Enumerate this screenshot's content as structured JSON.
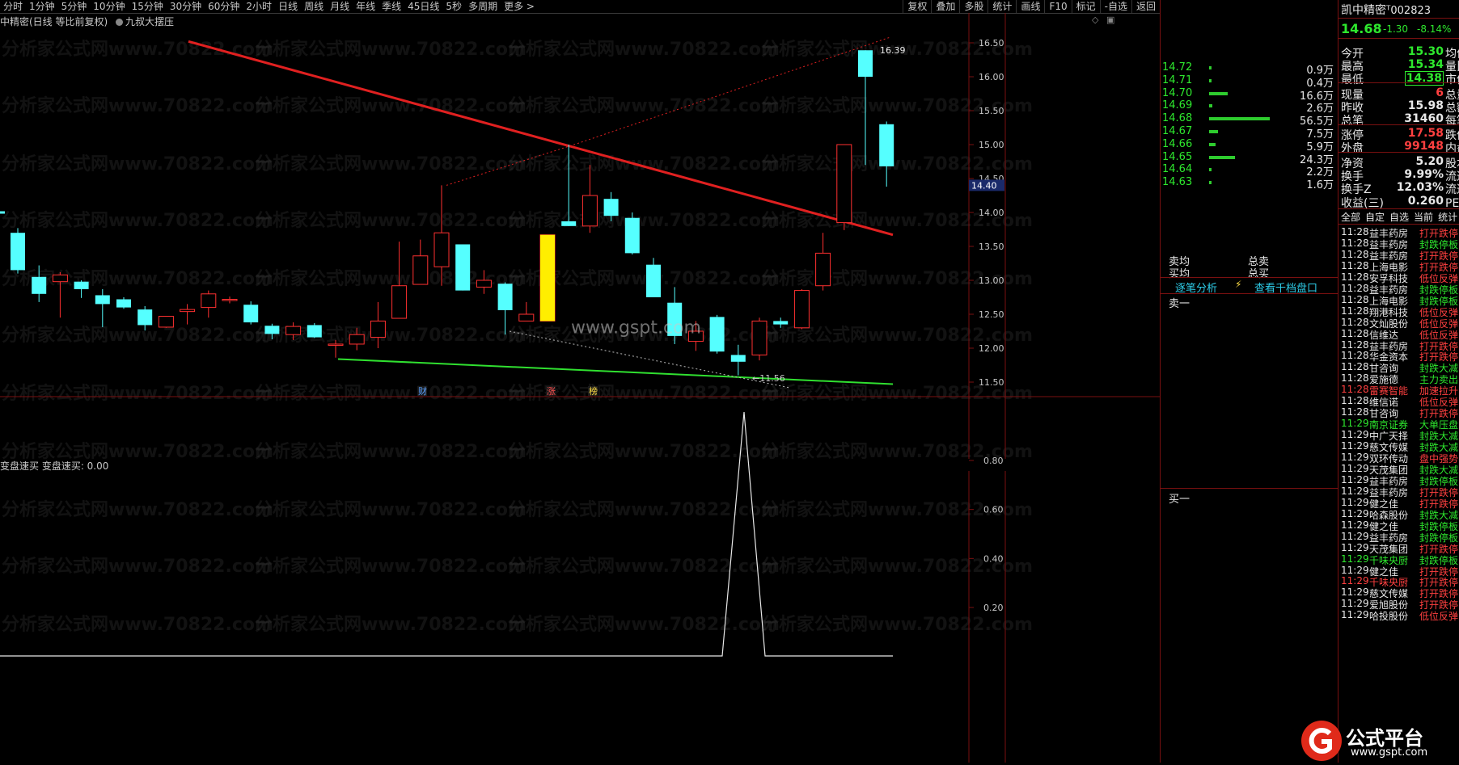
{
  "toolbar": {
    "periods": [
      "分时",
      "1分钟",
      "5分钟",
      "10分钟",
      "15分钟",
      "30分钟",
      "60分钟",
      "2小时",
      "日线",
      "周线",
      "月线",
      "年线",
      "季线",
      "45日线",
      "5秒",
      "多周期",
      "更多 >"
    ],
    "tools": [
      "复权",
      "叠加",
      "多股",
      "统计",
      "画线",
      "F10",
      "标记",
      "-自选",
      "返回"
    ]
  },
  "chart": {
    "title": "中精密(日线 等比前复权)",
    "indicator_name": "九叔大摆压",
    "marker_labels": [
      "财",
      "涨",
      "榜"
    ],
    "high_label": "16.39",
    "low_label": "11.56",
    "current_price_tag": "14.40",
    "site_text": "www.gspt.com",
    "y_ticks": [
      "16.50",
      "16.00",
      "15.50",
      "15.00",
      "14.50",
      "14.00",
      "13.50",
      "13.00",
      "12.50",
      "12.00",
      "11.50"
    ]
  },
  "indicator": {
    "title": "变盘速买  变盘速买: 0.00",
    "y_ticks": [
      "0.80",
      "0.60",
      "0.40",
      "0.20"
    ]
  },
  "watermark": "分析家公式网www.70822.com",
  "orderbook": {
    "rows": [
      {
        "price": "14.72",
        "vol": "0.9万",
        "bar": 0.02
      },
      {
        "price": "14.71",
        "vol": "0.4万",
        "bar": 0.01
      },
      {
        "price": "14.70",
        "vol": "16.6万",
        "bar": 0.3
      },
      {
        "price": "14.69",
        "vol": "2.6万",
        "bar": 0.05
      },
      {
        "price": "14.68",
        "vol": "56.5万",
        "bar": 1.0
      },
      {
        "price": "14.67",
        "vol": "7.5万",
        "bar": 0.14
      },
      {
        "price": "14.66",
        "vol": "5.9万",
        "bar": 0.11
      },
      {
        "price": "14.65",
        "vol": "24.3万",
        "bar": 0.43
      },
      {
        "price": "14.64",
        "vol": "2.2万",
        "bar": 0.04
      },
      {
        "price": "14.63",
        "vol": "1.6万",
        "bar": 0.03
      }
    ],
    "sell_avg_label": "卖均",
    "total_sell_label": "总卖",
    "buy_avg_label": "买均",
    "total_buy_label": "总买",
    "tick_analysis": "逐笔分析",
    "view_depth": "查看千档盘口",
    "sell_one": "卖一",
    "buy_one": "买一"
  },
  "quote": {
    "name": "凯中精密",
    "code": "002823",
    "price": "14.68",
    "change": "-1.30",
    "change_pct": "-8.14%",
    "rows": [
      {
        "k": "今开",
        "v": "15.30",
        "k2": "均价",
        "c": "#2ee82e"
      },
      {
        "k": "最高",
        "v": "15.34",
        "k2": "量比",
        "c": "#2ee82e"
      },
      {
        "k": "最低",
        "v": "14.38",
        "k2": "市值",
        "c": "#2ee82e"
      },
      {
        "k": "现量",
        "v": "6",
        "k2": "总量",
        "c": "#ff4040"
      },
      {
        "k": "昨收",
        "v": "15.98",
        "k2": "总额",
        "c": "#e8e8e8"
      },
      {
        "k": "总笔",
        "v": "31460",
        "k2": "每笔",
        "c": "#e8e8e8"
      },
      {
        "k": "涨停",
        "v": "17.58",
        "k2": "跌停",
        "c": "#ff4040"
      },
      {
        "k": "外盘",
        "v": "99148",
        "k2": "内盘",
        "c": "#ff4040"
      },
      {
        "k": "净资",
        "v": "5.20",
        "k2": "股本",
        "c": "#e8e8e8"
      },
      {
        "k": "换手",
        "v": "9.99%",
        "k2": "流通",
        "c": "#e8e8e8"
      },
      {
        "k": "换手Z",
        "v": "12.03%",
        "k2": "流通",
        "c": "#e8e8e8"
      },
      {
        "k": "收益(三)",
        "v": "0.260",
        "k2": "PE(动)",
        "c": "#e8e8e8"
      }
    ],
    "tabs": [
      "全部",
      "自定",
      "自选",
      "当前",
      "统计"
    ],
    "news": [
      {
        "t": "11:28",
        "n": "益丰药房",
        "e": "打开跌停",
        "c": "#ff4040",
        "tc": "#e8e8e8"
      },
      {
        "t": "11:28",
        "n": "益丰药房",
        "e": "封跌停板",
        "c": "#2ee82e",
        "tc": "#e8e8e8"
      },
      {
        "t": "11:28",
        "n": "益丰药房",
        "e": "打开跌停",
        "c": "#ff4040",
        "tc": "#e8e8e8"
      },
      {
        "t": "11:28",
        "n": "上海电影",
        "e": "打开跌停",
        "c": "#ff4040",
        "tc": "#e8e8e8"
      },
      {
        "t": "11:28",
        "n": "安孚科技",
        "e": "低位反弹",
        "c": "#ff4040",
        "tc": "#e8e8e8"
      },
      {
        "t": "11:28",
        "n": "益丰药房",
        "e": "封跌停板",
        "c": "#2ee82e",
        "tc": "#e8e8e8"
      },
      {
        "t": "11:28",
        "n": "上海电影",
        "e": "封跌停板",
        "c": "#2ee82e",
        "tc": "#e8e8e8"
      },
      {
        "t": "11:28",
        "n": "翔港科技",
        "e": "低位反弹",
        "c": "#ff4040",
        "tc": "#e8e8e8"
      },
      {
        "t": "11:28",
        "n": "文灿股份",
        "e": "低位反弹",
        "c": "#ff4040",
        "tc": "#e8e8e8"
      },
      {
        "t": "11:28",
        "n": "信维达",
        "e": "低位反弹",
        "c": "#ff4040",
        "tc": "#e8e8e8"
      },
      {
        "t": "11:28",
        "n": "益丰药房",
        "e": "打开跌停",
        "c": "#ff4040",
        "tc": "#e8e8e8"
      },
      {
        "t": "11:28",
        "n": "华金资本",
        "e": "打开跌停",
        "c": "#ff4040",
        "tc": "#e8e8e8"
      },
      {
        "t": "11:28",
        "n": "甘咨询",
        "e": "封跌大减",
        "c": "#2ee82e",
        "tc": "#e8e8e8"
      },
      {
        "t": "11:28",
        "n": "爱施德",
        "e": "主力卖出",
        "c": "#2ee82e",
        "tc": "#e8e8e8"
      },
      {
        "t": "11:28",
        "n": "雷赛智能",
        "e": "加速拉升",
        "c": "#ff4040",
        "tc": "#ff4040"
      },
      {
        "t": "11:28",
        "n": "维信诺",
        "e": "低位反弹",
        "c": "#ff4040",
        "tc": "#e8e8e8"
      },
      {
        "t": "11:28",
        "n": "甘咨询",
        "e": "打开跌停",
        "c": "#ff4040",
        "tc": "#e8e8e8"
      },
      {
        "t": "11:29",
        "n": "南京证券",
        "e": "大单压盘",
        "c": "#2ee82e",
        "tc": "#2ee82e"
      },
      {
        "t": "11:29",
        "n": "中广天择",
        "e": "封跌大减",
        "c": "#2ee82e",
        "tc": "#e8e8e8"
      },
      {
        "t": "11:29",
        "n": "慈文传媒",
        "e": "封跌大减",
        "c": "#2ee82e",
        "tc": "#e8e8e8"
      },
      {
        "t": "11:29",
        "n": "双环传动",
        "e": "盘中强势",
        "c": "#ff4040",
        "tc": "#e8e8e8"
      },
      {
        "t": "11:29",
        "n": "天茂集团",
        "e": "封跌大减",
        "c": "#2ee82e",
        "tc": "#e8e8e8"
      },
      {
        "t": "11:29",
        "n": "益丰药房",
        "e": "封跌停板",
        "c": "#2ee82e",
        "tc": "#e8e8e8"
      },
      {
        "t": "11:29",
        "n": "益丰药房",
        "e": "打开跌停",
        "c": "#ff4040",
        "tc": "#e8e8e8"
      },
      {
        "t": "11:29",
        "n": "健之佳",
        "e": "打开跌停",
        "c": "#ff4040",
        "tc": "#e8e8e8"
      },
      {
        "t": "11:29",
        "n": "哈森股份",
        "e": "封跌大减",
        "c": "#2ee82e",
        "tc": "#e8e8e8"
      },
      {
        "t": "11:29",
        "n": "健之佳",
        "e": "封跌停板",
        "c": "#2ee82e",
        "tc": "#e8e8e8"
      },
      {
        "t": "11:29",
        "n": "益丰药房",
        "e": "封跌停板",
        "c": "#2ee82e",
        "tc": "#e8e8e8"
      },
      {
        "t": "11:29",
        "n": "天茂集团",
        "e": "打开跌停",
        "c": "#ff4040",
        "tc": "#e8e8e8"
      },
      {
        "t": "11:29",
        "n": "千味央厨",
        "e": "封跌停板",
        "c": "#2ee82e",
        "tc": "#2ee82e"
      },
      {
        "t": "11:29",
        "n": "健之佳",
        "e": "打开跌停",
        "c": "#ff4040",
        "tc": "#e8e8e8"
      },
      {
        "t": "11:29",
        "n": "千味央厨",
        "e": "打开跌停",
        "c": "#ff4040",
        "tc": "#ff4040"
      },
      {
        "t": "11:29",
        "n": "慈文传媒",
        "e": "打开跌停",
        "c": "#ff4040",
        "tc": "#e8e8e8"
      },
      {
        "t": "11:29",
        "n": "爱旭股份",
        "e": "打开跌停",
        "c": "#ff4040",
        "tc": "#e8e8e8"
      },
      {
        "t": "11:29",
        "n": "哈投股份",
        "e": "低位反弹",
        "c": "#ff4040",
        "tc": "#e8e8e8"
      }
    ]
  },
  "logo": {
    "text": "公式平台",
    "url_text": "www.gspt.com"
  },
  "colors": {
    "up": "#ff3030",
    "down": "#55ffff",
    "resistance": "#e02020",
    "support": "#30e030",
    "highlight": "#ffee00",
    "border": "#7a1010"
  },
  "candles": [
    [
      13.7,
      13.15,
      13.77,
      13.1
    ],
    [
      13.05,
      12.8,
      13.22,
      12.68
    ],
    [
      12.98,
      13.08,
      13.12,
      12.45
    ],
    [
      12.98,
      12.87,
      13.0,
      12.74
    ],
    [
      12.78,
      12.65,
      12.87,
      12.31
    ],
    [
      12.72,
      12.6,
      12.75,
      12.58
    ],
    [
      12.57,
      12.34,
      12.62,
      12.26
    ],
    [
      12.31,
      12.47,
      12.47,
      12.3
    ],
    [
      12.54,
      12.57,
      12.65,
      12.35
    ],
    [
      12.6,
      12.8,
      12.85,
      12.45
    ],
    [
      12.72,
      12.72,
      12.76,
      12.66
    ],
    [
      12.64,
      12.38,
      12.69,
      12.35
    ],
    [
      12.33,
      12.21,
      12.36,
      12.13
    ],
    [
      12.2,
      12.32,
      12.38,
      12.12
    ],
    [
      12.34,
      12.16,
      12.37,
      12.15
    ],
    [
      12.06,
      12.06,
      12.12,
      11.86
    ],
    [
      12.06,
      12.2,
      12.3,
      11.97
    ],
    [
      12.16,
      12.4,
      12.68,
      12.0
    ],
    [
      12.44,
      12.92,
      13.57,
      12.44
    ],
    [
      12.94,
      13.36,
      13.6,
      12.94
    ],
    [
      13.2,
      13.7,
      14.4,
      12.92
    ],
    [
      13.53,
      12.85,
      13.53,
      12.85
    ],
    [
      12.9,
      13.0,
      13.15,
      12.8
    ],
    [
      12.95,
      12.56,
      12.97,
      12.2
    ],
    [
      12.4,
      12.5,
      12.68,
      12.4
    ],
    [
      12.4,
      13.67,
      13.67,
      12.4
    ],
    [
      13.87,
      13.8,
      15.0,
      13.8
    ],
    [
      13.8,
      14.25,
      14.7,
      13.7
    ],
    [
      14.2,
      13.95,
      14.3,
      13.87
    ],
    [
      13.92,
      13.4,
      14.0,
      13.38
    ],
    [
      13.23,
      12.75,
      13.33,
      12.75
    ],
    [
      12.67,
      12.18,
      12.9,
      12.06
    ],
    [
      12.1,
      12.25,
      12.4,
      11.96
    ],
    [
      12.46,
      11.95,
      12.49,
      11.92
    ],
    [
      11.9,
      11.8,
      12.05,
      11.6
    ],
    [
      11.9,
      12.4,
      12.45,
      11.82
    ],
    [
      12.4,
      12.35,
      12.45,
      12.3
    ],
    [
      12.3,
      12.85,
      12.87,
      12.28
    ],
    [
      12.92,
      13.4,
      13.7,
      12.85
    ],
    [
      13.85,
      15.0,
      15.0,
      13.74
    ],
    [
      16.39,
      16.0,
      16.39,
      14.7
    ],
    [
      15.3,
      14.68,
      15.34,
      14.38
    ]
  ],
  "indicator_series": [
    0,
    0,
    0,
    0,
    0,
    0,
    0,
    0,
    0,
    0,
    0,
    0,
    0,
    0,
    0,
    0,
    0,
    0,
    0,
    0,
    0,
    0,
    0,
    0,
    0,
    0,
    0,
    0,
    0,
    0,
    0,
    0,
    0,
    0,
    1,
    0,
    0,
    0,
    0,
    0,
    0,
    0
  ]
}
